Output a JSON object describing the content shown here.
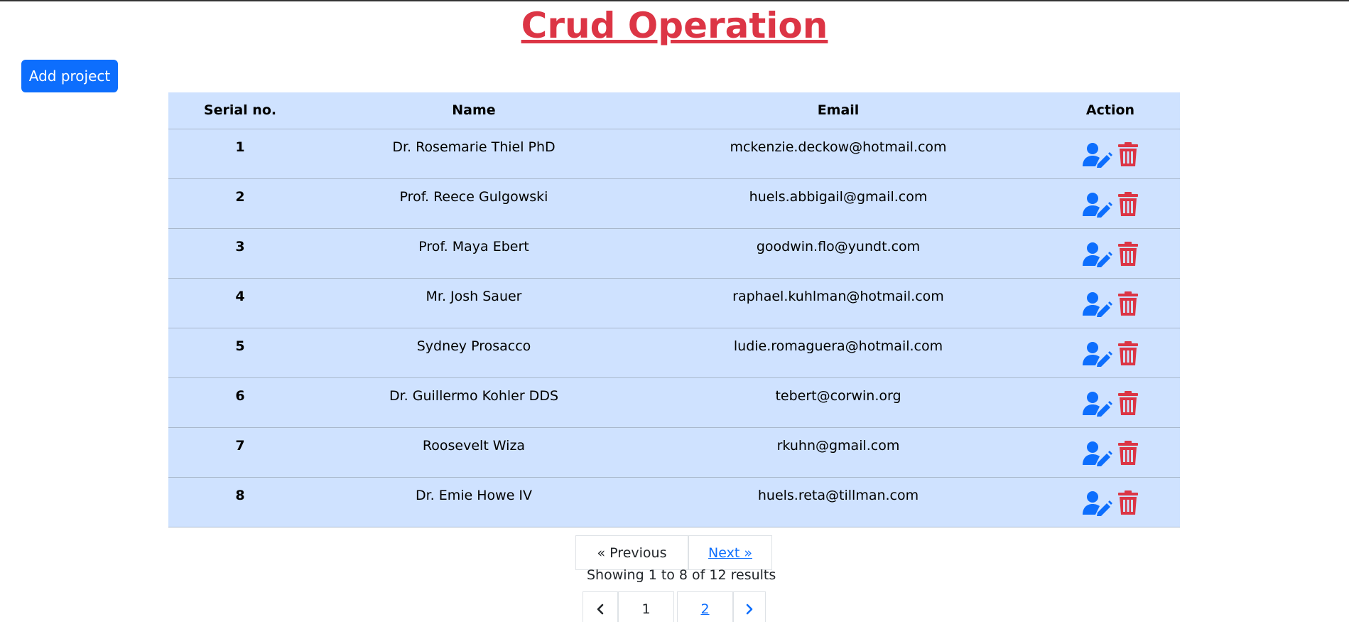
{
  "page": {
    "title": "Crud Operation"
  },
  "toolbar": {
    "add_label": "Add project"
  },
  "table": {
    "headers": [
      "Serial no.",
      "Name",
      "Email",
      "Action"
    ],
    "rows": [
      {
        "serial": "1",
        "name": "Dr. Rosemarie Thiel PhD",
        "email": "mckenzie.deckow@hotmail.com"
      },
      {
        "serial": "2",
        "name": "Prof. Reece Gulgowski",
        "email": "huels.abbigail@gmail.com"
      },
      {
        "serial": "3",
        "name": "Prof. Maya Ebert",
        "email": "goodwin.flo@yundt.com"
      },
      {
        "serial": "4",
        "name": "Mr. Josh Sauer",
        "email": "raphael.kuhlman@hotmail.com"
      },
      {
        "serial": "5",
        "name": "Sydney Prosacco",
        "email": "ludie.romaguera@hotmail.com"
      },
      {
        "serial": "6",
        "name": "Dr. Guillermo Kohler DDS",
        "email": "tebert@corwin.org"
      },
      {
        "serial": "7",
        "name": "Roosevelt Wiza",
        "email": "rkuhn@gmail.com"
      },
      {
        "serial": "8",
        "name": "Dr. Emie Howe IV",
        "email": "huels.reta@tillman.com"
      }
    ],
    "action_icons": [
      "user-edit-icon",
      "trash-icon"
    ]
  },
  "pagination": {
    "previous_label": "« Previous",
    "next_label": "Next »",
    "summary": "Showing 1 to 8 of 12 results",
    "pages": [
      "1",
      "2"
    ],
    "current_page": "1"
  },
  "colors": {
    "title": "#dc3545",
    "primary": "#0d6efd",
    "danger": "#dc3545",
    "table_bg": "#cfe2ff"
  }
}
